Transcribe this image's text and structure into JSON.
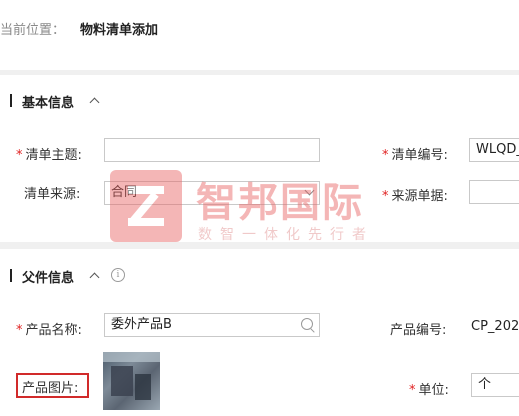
{
  "breadcrumb": {
    "prefix": "当前位置：",
    "current": "物料清单添加"
  },
  "basic_section": {
    "title": "基本信息",
    "fields": {
      "subject": {
        "label": "清单主题:",
        "value": ""
      },
      "code": {
        "label": "清单编号:",
        "value": "WLQD_"
      },
      "source": {
        "label": "清单来源:",
        "value": "合同"
      },
      "source_doc": {
        "label": "来源单据:",
        "value": ""
      }
    }
  },
  "parent_section": {
    "title": "父件信息",
    "fields": {
      "product_name": {
        "label": "产品名称:",
        "value": "委外产品B"
      },
      "product_code": {
        "label": "产品编号:",
        "value": "CP_202"
      },
      "product_image": {
        "label": "产品图片:"
      },
      "unit": {
        "label": "单位:",
        "value": "个"
      }
    }
  },
  "required_mark": "*",
  "watermark": {
    "title": "智邦国际",
    "subtitle": "数智一体化先行者"
  },
  "colors": {
    "required": "#e02020",
    "highlight_box": "#d12a2a"
  }
}
